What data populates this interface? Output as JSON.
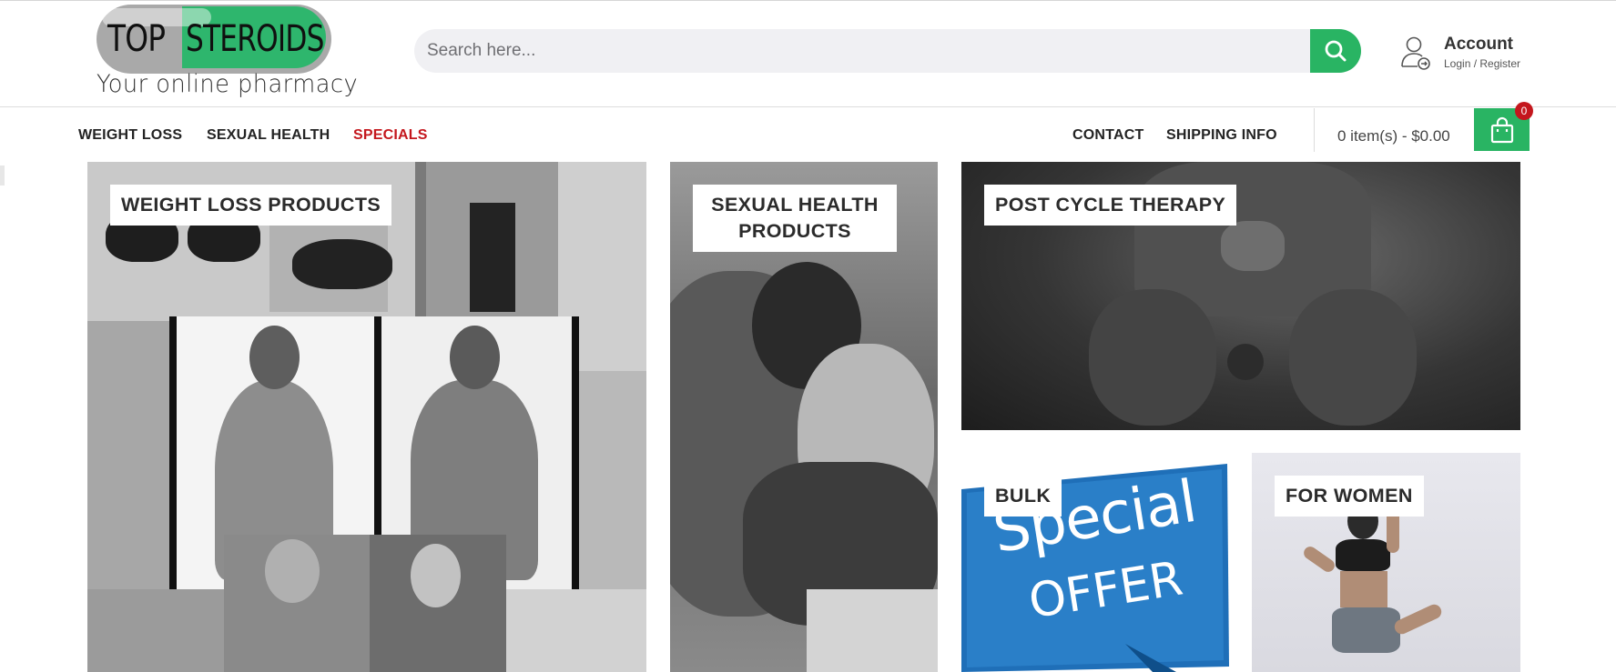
{
  "brand": {
    "logo_word_1": "TOP",
    "logo_word_2": "STEROIDS",
    "tagline": "Your online pharmacy",
    "accent_green": "#2eb66d",
    "accent_red": "#c4171d"
  },
  "search": {
    "placeholder": "Search here...",
    "button_icon": "search-icon"
  },
  "account": {
    "icon": "user-icon",
    "title": "Account",
    "subtitle": "Login / Register"
  },
  "nav": {
    "left": [
      {
        "label": "WEIGHT LOSS"
      },
      {
        "label": "SEXUAL HEALTH"
      },
      {
        "label": "SPECIALS"
      }
    ],
    "right": [
      {
        "label": "CONTACT"
      },
      {
        "label": "SHIPPING INFO"
      }
    ]
  },
  "cart": {
    "summary": "0 item(s) - $0.00",
    "badge_count": "0",
    "icon": "shopping-bag-icon"
  },
  "categories": [
    {
      "label": "WEIGHT LOSS PRODUCTS"
    },
    {
      "label": "SEXUAL HEALTH\nPRODUCTS"
    },
    {
      "label": "POST CYCLE THERAPY"
    },
    {
      "label": "BULK",
      "image_text_1": "Special",
      "image_text_2": "OFFER"
    },
    {
      "label": "FOR WOMEN"
    }
  ]
}
